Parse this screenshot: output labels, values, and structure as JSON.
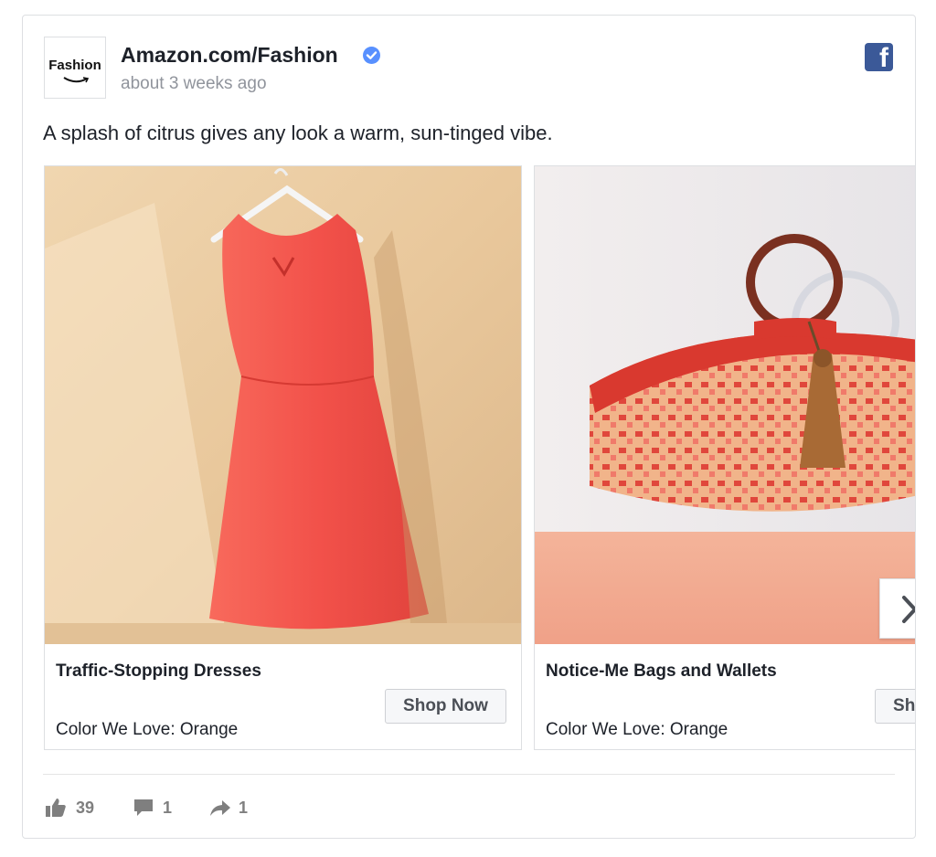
{
  "post": {
    "logo_text": "Fashion",
    "page_name": "Amazon.com/Fashion",
    "timestamp": "about 3 weeks ago",
    "message": "A splash of citrus gives any look a warm, sun-tinged vibe."
  },
  "carousel": [
    {
      "title": "Traffic-Stopping Dresses",
      "description": "Color We Love: Orange",
      "button": "Shop Now"
    },
    {
      "title": "Notice-Me Bags and Wallets",
      "description": "Color We Love: Orange",
      "button": "Shop Now"
    }
  ],
  "reactions": {
    "likes": "39",
    "comments": "1",
    "shares": "1"
  },
  "icons": [
    "verified-badge-icon",
    "facebook-logo-icon",
    "chevron-right-icon",
    "thumbs-up-icon",
    "comment-icon",
    "share-arrow-icon"
  ],
  "colors": {
    "facebook_blue": "#3b5998",
    "verified_blue": "#5890ff",
    "text_primary": "#1d2129",
    "text_secondary": "#90949c",
    "dress_coral": "#f2514a",
    "bag_red": "#d9392f"
  }
}
